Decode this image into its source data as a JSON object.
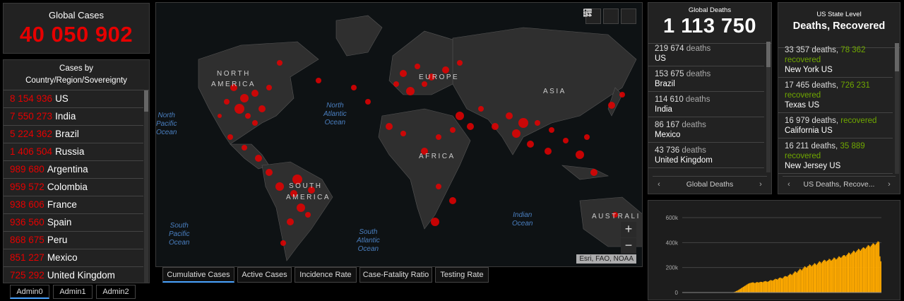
{
  "global_cases": {
    "label": "Global Cases",
    "value": "40 050 902"
  },
  "country_panel": {
    "header_line1": "Cases by",
    "header_line2": "Country/Region/Sovereignty",
    "items": [
      {
        "value": "8 154 936",
        "name": "US"
      },
      {
        "value": "7 550 273",
        "name": "India"
      },
      {
        "value": "5 224 362",
        "name": "Brazil"
      },
      {
        "value": "1 406 504",
        "name": "Russia"
      },
      {
        "value": "989 680",
        "name": "Argentina"
      },
      {
        "value": "959 572",
        "name": "Colombia"
      },
      {
        "value": "938 606",
        "name": "France"
      },
      {
        "value": "936 560",
        "name": "Spain"
      },
      {
        "value": "868 675",
        "name": "Peru"
      },
      {
        "value": "851 227",
        "name": "Mexico"
      },
      {
        "value": "725 292",
        "name": "United Kingdom"
      }
    ]
  },
  "admin_tabs": [
    "Admin0",
    "Admin1",
    "Admin2"
  ],
  "map": {
    "continent_labels": [
      "NORTH",
      "AMERICA",
      "SOUTH",
      "AMERICA",
      "EUROPE",
      "ASIA",
      "AFRICA",
      "AUSTRALI"
    ],
    "ocean_labels": [
      [
        "North",
        "Pacific",
        "Ocean"
      ],
      [
        "North",
        "Atlantic",
        "Ocean"
      ],
      [
        "South",
        "Pacific",
        "Ocean"
      ],
      [
        "South",
        "Atlantic",
        "Ocean"
      ],
      [
        "Indian",
        "Ocean"
      ]
    ],
    "attribution": "Esri, FAO, NOAA",
    "zoom_in": "+",
    "zoom_out": "−",
    "tool_icons": [
      "bookmark-icon",
      "list-icon",
      "qr-icon"
    ],
    "hotspot_color": "#e60000"
  },
  "map_tabs": [
    "Cumulative Cases",
    "Active Cases",
    "Incidence Rate",
    "Case-Fatality Ratio",
    "Testing Rate"
  ],
  "deaths_panel": {
    "label": "Global Deaths",
    "value": "1 113 750",
    "unit": "deaths",
    "items": [
      {
        "value": "219 674",
        "name": "US"
      },
      {
        "value": "153 675",
        "name": "Brazil"
      },
      {
        "value": "114 610",
        "name": "India"
      },
      {
        "value": "86 167",
        "name": "Mexico"
      },
      {
        "value": "43 736",
        "name": "United Kingdom"
      }
    ],
    "pager_label": "Global Deaths"
  },
  "state_panel": {
    "label": "US State Level",
    "title": "Deaths, Recovered",
    "items": [
      {
        "deaths": "33 357 deaths,",
        "recovered_value": "78 362",
        "recovered_word": "recovered",
        "name": "New York US"
      },
      {
        "deaths": "17 465 deaths,",
        "recovered_value": "726 231",
        "recovered_word": "recovered",
        "name": "Texas US"
      },
      {
        "deaths": "16 979 deaths,",
        "recovered_value": "",
        "recovered_word": "recovered",
        "name": "California US"
      },
      {
        "deaths": "16 211 deaths,",
        "recovered_value": "35 889",
        "recovered_word": "recovered",
        "name": "New Jersey US"
      }
    ],
    "pager_label": "US Deaths, Recove..."
  },
  "chart_data": {
    "type": "bar",
    "title": "",
    "xlabel": "",
    "ylabel": "",
    "ylim": [
      0,
      600000
    ],
    "y_ticks": [
      "0",
      "200k",
      "400k",
      "600k"
    ],
    "color": "#ffaa00",
    "series": [
      {
        "values": [
          0,
          0,
          0,
          0,
          0,
          0,
          0,
          0,
          0,
          0,
          0,
          0,
          0,
          0,
          0,
          0,
          0,
          0,
          0,
          0,
          0,
          0,
          0,
          0,
          0,
          0,
          0,
          0,
          0,
          0,
          0,
          0,
          0,
          0,
          0,
          0,
          0,
          0,
          0,
          0,
          0,
          0,
          0,
          0,
          0,
          0,
          0,
          0,
          0,
          0,
          1000,
          2000,
          3000,
          5000,
          8000,
          12000,
          16000,
          20000,
          25000,
          30000,
          35000,
          40000,
          45000,
          50000,
          55000,
          60000,
          65000,
          70000,
          74000,
          76000,
          78000,
          80000,
          82000,
          78000,
          76000,
          80000,
          84000,
          82000,
          80000,
          84000,
          86000,
          85000,
          82000,
          88000,
          90000,
          92000,
          88000,
          86000,
          90000,
          95000,
          100000,
          98000,
          95000,
          100000,
          105000,
          110000,
          108000,
          104000,
          112000,
          118000,
          120000,
          116000,
          112000,
          120000,
          128000,
          132000,
          130000,
          126000,
          135000,
          142000,
          150000,
          145000,
          140000,
          150000,
          160000,
          170000,
          165000,
          158000,
          170000,
          180000,
          190000,
          185000,
          178000,
          190000,
          200000,
          210000,
          205000,
          198000,
          210000,
          215000,
          225000,
          220000,
          210000,
          218000,
          225000,
          235000,
          230000,
          220000,
          230000,
          240000,
          250000,
          245000,
          235000,
          245000,
          255000,
          262000,
          258000,
          248000,
          255000,
          260000,
          270000,
          265000,
          255000,
          262000,
          270000,
          280000,
          275000,
          265000,
          270000,
          280000,
          290000,
          285000,
          278000,
          285000,
          295000,
          300000,
          298000,
          290000,
          300000,
          310000,
          320000,
          315000,
          305000,
          315000,
          325000,
          335000,
          330000,
          320000,
          330000,
          340000,
          350000,
          345000,
          335000,
          345000,
          355000,
          362000,
          358000,
          350000,
          360000,
          370000,
          380000,
          375000,
          365000,
          375000,
          385000,
          395000,
          390000,
          380000,
          390000,
          400000,
          410000,
          405000,
          290000,
          250000
        ]
      }
    ]
  }
}
